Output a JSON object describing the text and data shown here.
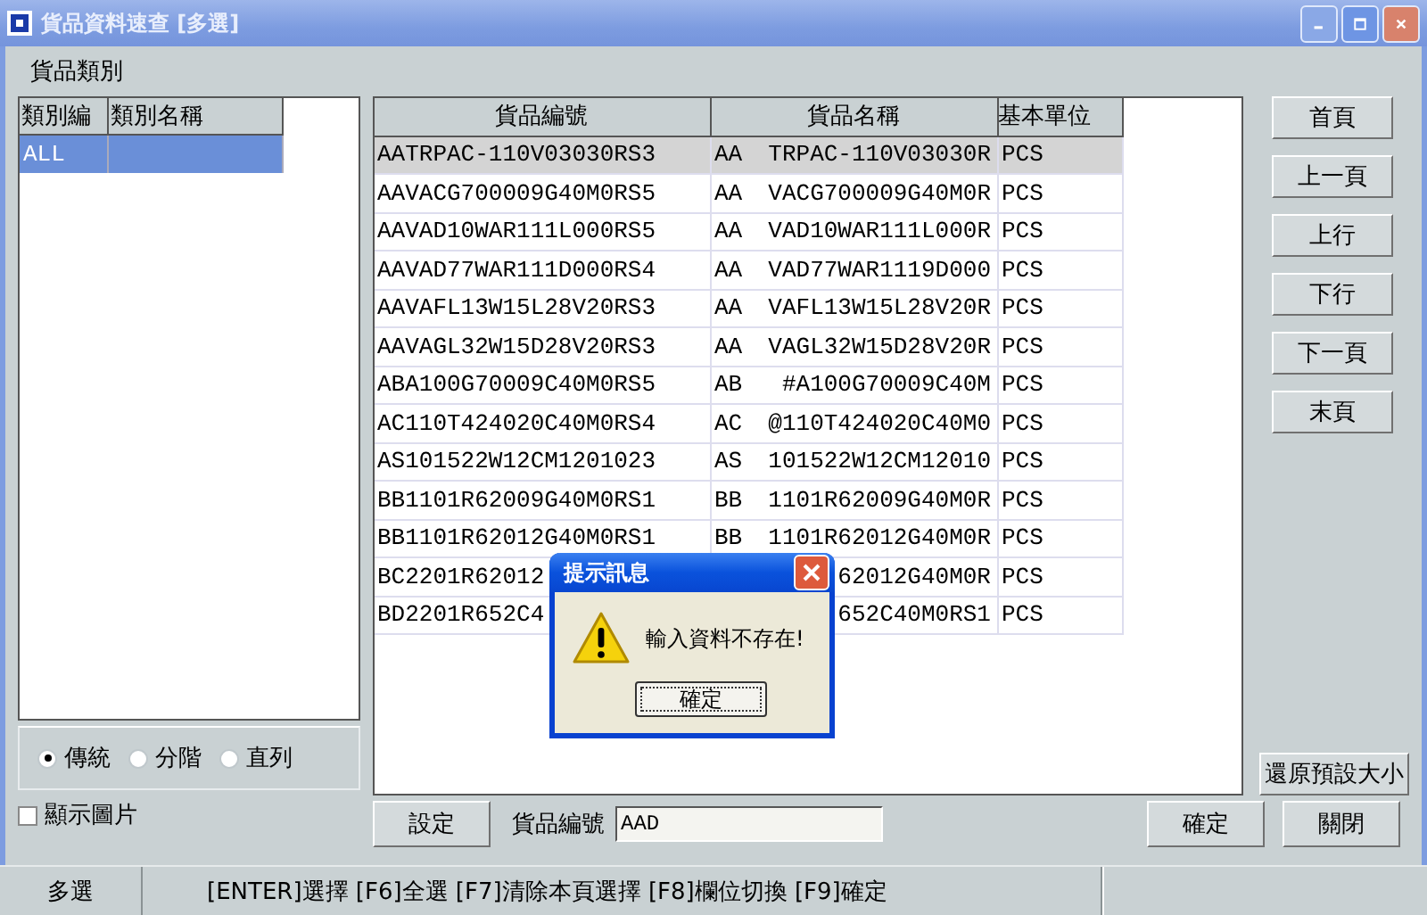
{
  "window": {
    "title": "貨品資料速查 [多選]"
  },
  "category_label": "貨品類別",
  "category_list": {
    "columns": [
      "類別編",
      "類別名稱"
    ],
    "rows": [
      {
        "code": "ALL",
        "selected": true
      }
    ]
  },
  "view_modes": [
    {
      "label": "傳統",
      "selected": true
    },
    {
      "label": "分階",
      "selected": false
    },
    {
      "label": "直列",
      "selected": false
    }
  ],
  "show_images": {
    "label": "顯示圖片",
    "checked": false
  },
  "table": {
    "columns": [
      "貨品編號",
      "貨品名稱",
      "基本單位"
    ],
    "rows": [
      {
        "code": "AATRPAC-110V03030RS3",
        "category": "AA",
        "name": "TRPAC-110V03030R",
        "unit": "PCS",
        "selected": true
      },
      {
        "code": "AAVACG700009G40M0RS5",
        "category": "AA",
        "name": "VACG700009G40M0R",
        "unit": "PCS",
        "selected": false
      },
      {
        "code": "AAVAD10WAR111L000RS5",
        "category": "AA",
        "name": "VAD10WAR111L000R",
        "unit": "PCS",
        "selected": false
      },
      {
        "code": "AAVAD77WAR111D000RS4",
        "category": "AA",
        "name": "VAD77WAR1119D000",
        "unit": "PCS",
        "selected": false
      },
      {
        "code": "AAVAFL13W15L28V20RS3",
        "category": "AA",
        "name": "VAFL13W15L28V20R",
        "unit": "PCS",
        "selected": false
      },
      {
        "code": "AAVAGL32W15D28V20RS3",
        "category": "AA",
        "name": "VAGL32W15D28V20R",
        "unit": "PCS",
        "selected": false
      },
      {
        "code": "ABA100G70009C40M0RS5",
        "category": "AB",
        "name": "#A100G70009C40M",
        "unit": "PCS",
        "selected": false
      },
      {
        "code": "AC110T424020C40M0RS4",
        "category": "AC",
        "name": "@110T424020C40M0",
        "unit": "PCS",
        "selected": false
      },
      {
        "code": "AS101522W12CM1201023",
        "category": "AS",
        "name": "101522W12CM12010",
        "unit": "PCS",
        "selected": false
      },
      {
        "code": "BB1101R62009G40M0RS1",
        "category": "BB",
        "name": "1101R62009G40M0R",
        "unit": "PCS",
        "selected": false
      },
      {
        "code": "BB1101R62012G40M0RS1",
        "category": "BB",
        "name": "1101R62012G40M0R",
        "unit": "PCS",
        "selected": false
      },
      {
        "code": "BC2201R62012",
        "name": "62012G40M0R",
        "unit": "PCS",
        "selected": false
      },
      {
        "code": "BD2201R652C4",
        "name": "652C40M0RS1",
        "unit": "PCS",
        "selected": false
      }
    ]
  },
  "nav_buttons": [
    "首頁",
    "上一頁",
    "上行",
    "下行",
    "下一頁",
    "末頁"
  ],
  "restore_button": "還原預設大小",
  "settings_button": "設定",
  "search": {
    "label": "貨品編號",
    "value": "AAD"
  },
  "confirm_button": "確定",
  "close_button": "關閉",
  "status_bar": {
    "mode": "多選",
    "hint": "[ENTER]選擇 [F6]全選 [F7]清除本頁選擇 [F8]欄位切換 [F9]確定"
  },
  "dialog": {
    "title": "提示訊息",
    "message": "輸入資料不存在!",
    "ok_button": "確定"
  }
}
